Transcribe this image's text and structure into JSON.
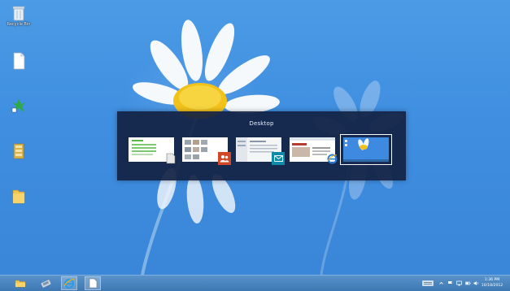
{
  "desktop": {
    "icons": [
      {
        "name": "recycle-bin-icon",
        "label": "Recycle Bin"
      },
      {
        "name": "document-icon",
        "label": ""
      },
      {
        "name": "app-shortcut-icon",
        "label": ""
      },
      {
        "name": "folder-shortcut-icon",
        "label": ""
      },
      {
        "name": "folder-icon",
        "label": ""
      }
    ]
  },
  "switcher": {
    "title": "Desktop",
    "windows": [
      {
        "name": "thumb-window-1",
        "badge": "document-icon",
        "badge_color": "#e8e8e8",
        "accent": "#59b84a"
      },
      {
        "name": "thumb-window-2",
        "badge": "people-icon",
        "badge_color": "#d24726",
        "accent": "#c9c9c9"
      },
      {
        "name": "thumb-window-3",
        "badge": "mail-icon",
        "badge_color": "#0f8aa8",
        "accent": "#4f8fc8"
      },
      {
        "name": "thumb-window-4",
        "badge": "internet-explorer-icon",
        "badge_color": "#2d7fd0",
        "accent": "#b43b2e"
      },
      {
        "name": "thumb-desktop",
        "badge": "",
        "badge_color": "",
        "accent": "#3d8ae0",
        "selected": true
      }
    ]
  },
  "taskbar": {
    "pinned": [
      "file-explorer-icon",
      "app-icon",
      "internet-explorer-icon",
      "document-icon"
    ],
    "clock": {
      "time": "1:36 PM",
      "date": "10/18/2012"
    }
  },
  "colors": {
    "sky": "#3f8ee0",
    "switcher_bg": "#122142",
    "taskbar": "#3d78b4"
  }
}
